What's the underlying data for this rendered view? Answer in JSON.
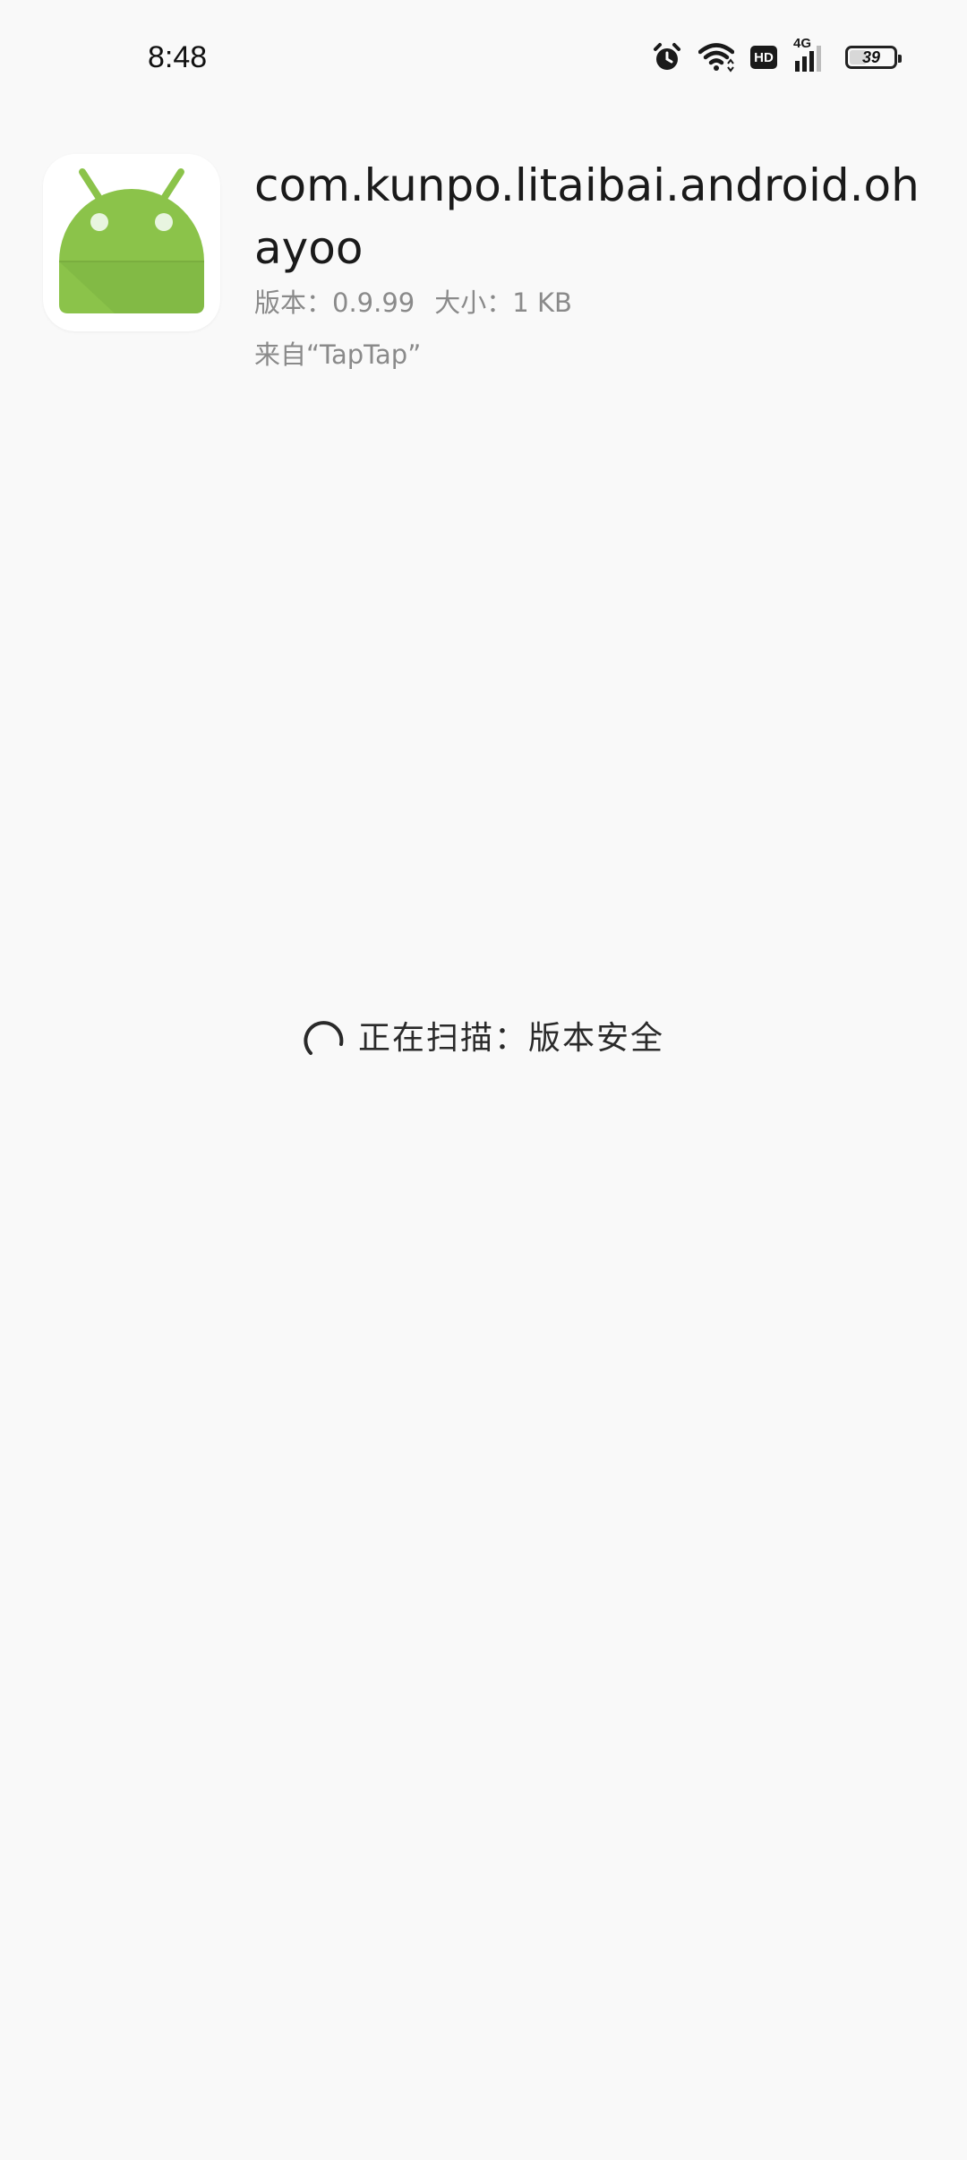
{
  "status_bar": {
    "time": "8:48",
    "icons": [
      "alarm-icon",
      "wifi-icon",
      "hd-icon",
      "signal-4g-icon",
      "battery-icon"
    ],
    "hd_label": "HD",
    "network_label": "4G",
    "battery_level": "39",
    "battery_fraction": 0.39
  },
  "app": {
    "icon": "android-icon",
    "icon_colors": {
      "body": "#8bc34a",
      "background": "#ffffff"
    },
    "package_name": "com.kunpo.litaibai.android.ohayoo",
    "version_label": "版本：",
    "version": "0.9.99",
    "size_label": "大小：",
    "size": "1 KB",
    "source_prefix": "来自“",
    "source": "TapTap",
    "source_suffix": "”"
  },
  "scan": {
    "icon": "loading-spinner-icon",
    "prefix": "正在扫描：",
    "item": "版本安全"
  }
}
